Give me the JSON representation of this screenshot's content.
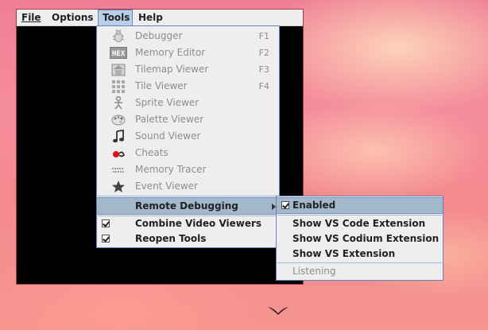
{
  "menubar": [
    {
      "label": "File"
    },
    {
      "label": "Options"
    },
    {
      "label": "Tools",
      "active": true
    },
    {
      "label": "Help"
    }
  ],
  "tools_menu": {
    "items": [
      {
        "label": "Debugger",
        "shortcut": "F1",
        "icon": "bug-icon",
        "enabled": false
      },
      {
        "label": "Memory Editor",
        "shortcut": "F2",
        "icon": "hex-icon",
        "enabled": false
      },
      {
        "label": "Tilemap Viewer",
        "shortcut": "F3",
        "icon": "tilemap-icon",
        "enabled": false
      },
      {
        "label": "Tile Viewer",
        "shortcut": "F4",
        "icon": "tile-grid-icon",
        "enabled": false
      },
      {
        "label": "Sprite Viewer",
        "icon": "sprite-icon",
        "enabled": false
      },
      {
        "label": "Palette Viewer",
        "icon": "palette-icon",
        "enabled": false
      },
      {
        "label": "Sound Viewer",
        "icon": "music-note-icon",
        "enabled": false
      },
      {
        "label": "Cheats",
        "icon": "cheat-icon",
        "enabled": false
      },
      {
        "label": "Memory Tracer",
        "icon": "tracer-icon",
        "enabled": false
      },
      {
        "label": "Event Viewer",
        "icon": "star-icon",
        "enabled": false
      }
    ],
    "remote_debugging": "Remote Debugging",
    "combine_video_viewers": "Combine Video Viewers",
    "reopen_tools": "Reopen Tools"
  },
  "remote_debugging_menu": {
    "enabled": "Enabled",
    "show_vs_code": "Show VS Code Extension",
    "show_vs_codium": "Show VS Codium Extension",
    "show_vs": "Show VS Extension",
    "listening": "Listening"
  },
  "colors": {
    "menu_bg": "#eeeeee",
    "selected_bg": "#a3b8cc",
    "border": "#6382bf",
    "disabled_text": "#8d8d8d"
  }
}
